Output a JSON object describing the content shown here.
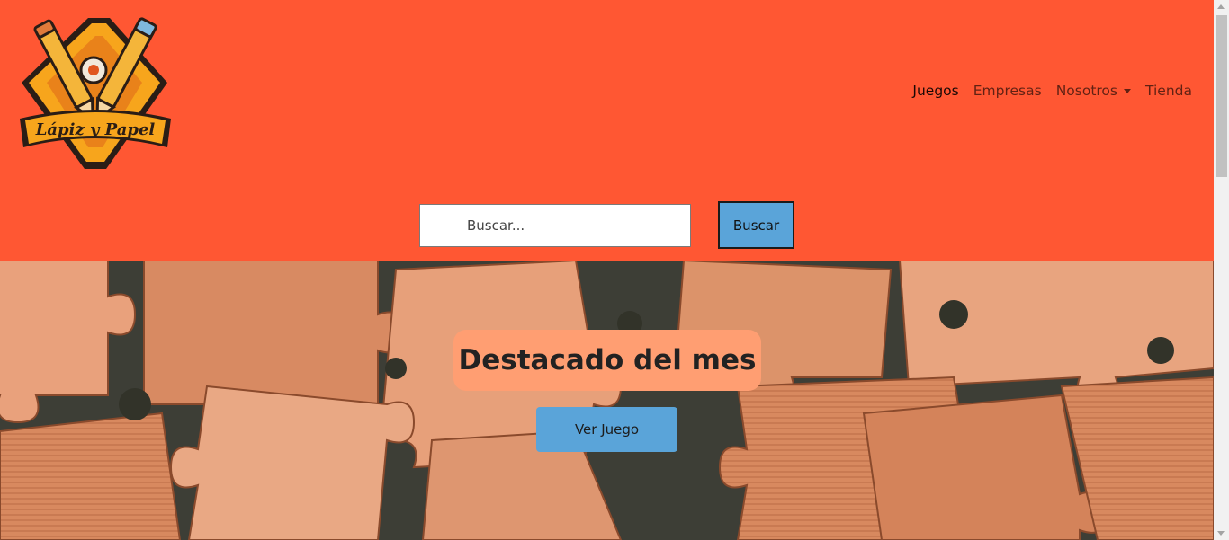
{
  "brand": {
    "logo_text": "Lápiz y Papel",
    "logo_icon": "pencil-crossed-dice-logo"
  },
  "nav": {
    "items": [
      {
        "label": "Juegos",
        "active": true
      },
      {
        "label": "Empresas",
        "active": false
      },
      {
        "label": "Nosotros",
        "active": false,
        "dropdown": true
      },
      {
        "label": "Tienda",
        "active": false
      }
    ]
  },
  "search": {
    "placeholder": "Buscar...",
    "value": "",
    "button_label": "Buscar"
  },
  "hero": {
    "title": "Destacado del mes",
    "button_label": "Ver Juego",
    "background_icon": "puzzle-pieces-image"
  },
  "colors": {
    "header_bg": "#ff5733",
    "button_bg": "#5aa4d9",
    "hero_title_bg": "#ff9e72"
  }
}
